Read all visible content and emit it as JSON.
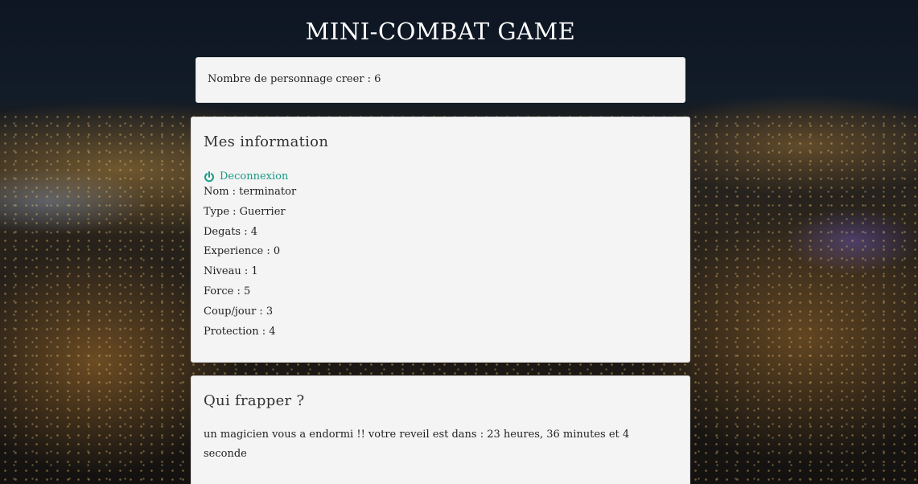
{
  "header": {
    "title": "MINI-COMBAT GAME"
  },
  "counter": {
    "text": "Nombre de personnage creer : 6"
  },
  "info_panel": {
    "heading": "Mes information",
    "logout_label": "Deconnexion",
    "logout_icon": "power-icon",
    "lines": [
      "Nom : terminator",
      "Type : Guerrier",
      "Degats : 4",
      "Experience : 0",
      "Niveau : 1",
      "Force : 5",
      "Coup/jour : 3",
      "Protection : 4"
    ]
  },
  "target_panel": {
    "heading": "Qui frapper ?",
    "message": "un magicien vous a endormi !! votre reveil est dans : 23 heures, 36 minutes et 4 seconde"
  },
  "colors": {
    "accent": "#199a84",
    "panel_bg": "#f4f4f4",
    "title_text": "#ffffff"
  }
}
